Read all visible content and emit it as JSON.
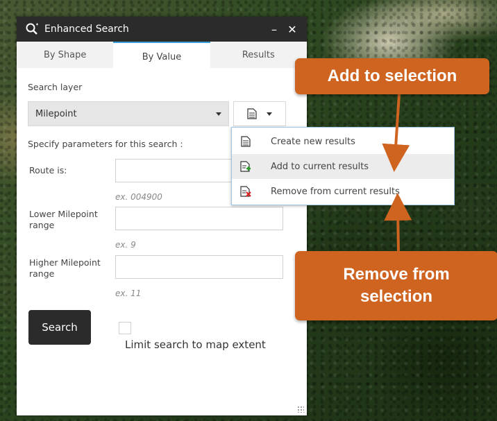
{
  "widget": {
    "title": "Enhanced Search",
    "minimize": "–",
    "close": "✕"
  },
  "tabs": [
    {
      "label": "By Shape"
    },
    {
      "label": "By Value",
      "active": true
    },
    {
      "label": "Results"
    }
  ],
  "form": {
    "search_layer_label": "Search layer",
    "search_layer_value": "Milepoint",
    "params_label": "Specify parameters for this search :",
    "fields": [
      {
        "label": "Route is:",
        "value": "",
        "hint": "ex. 004900"
      },
      {
        "label": "Lower Milepoint range",
        "label_line1": "Lower Milepoint",
        "label_line2": "range",
        "value": "",
        "hint": "ex. 9"
      },
      {
        "label": "Higher Milepoint range",
        "label_line1": "Higher Milepoint",
        "label_line2": "range",
        "value": "",
        "hint": "ex. 11"
      }
    ],
    "search_button": "Search",
    "limit_checkbox_label": "Limit search to map extent",
    "limit_checked": false
  },
  "menu": {
    "items": [
      {
        "label": "Create new results",
        "icon": "document-icon"
      },
      {
        "label": "Add to current results",
        "icon": "document-add-icon"
      },
      {
        "label": "Remove from current results",
        "icon": "document-remove-icon"
      }
    ]
  },
  "callouts": {
    "add": "Add to selection",
    "remove_line1": "Remove from",
    "remove_line2": "selection"
  },
  "colors": {
    "accent_tab": "#3aa0dc",
    "callout": "#cf6420",
    "dark": "#2b2b2b"
  }
}
